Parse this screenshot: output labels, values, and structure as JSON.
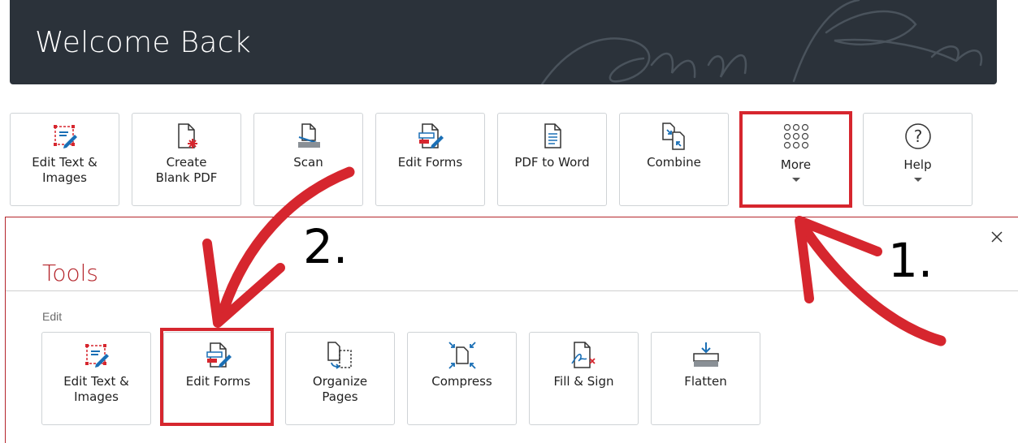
{
  "banner": {
    "title": "Welcome Back"
  },
  "top_tools": [
    {
      "label": "Edit Text &\nImages",
      "icon": "edit-text-images-icon"
    },
    {
      "label": "Create\nBlank PDF",
      "icon": "create-blank-pdf-icon"
    },
    {
      "label": "Scan",
      "icon": "scan-icon"
    },
    {
      "label": "Edit Forms",
      "icon": "edit-forms-icon"
    },
    {
      "label": "PDF to Word",
      "icon": "pdf-to-word-icon"
    },
    {
      "label": "Combine",
      "icon": "combine-icon"
    },
    {
      "label": "More",
      "icon": "grid-dots-icon"
    },
    {
      "label": "Help",
      "icon": "help-icon"
    }
  ],
  "tools_panel": {
    "title": "Tools",
    "section_label": "Edit",
    "tools": [
      {
        "label": "Edit Text &\nImages",
        "icon": "edit-text-images-icon"
      },
      {
        "label": "Edit Forms",
        "icon": "edit-forms-icon"
      },
      {
        "label": "Organize\nPages",
        "icon": "organize-pages-icon"
      },
      {
        "label": "Compress",
        "icon": "compress-icon"
      },
      {
        "label": "Fill & Sign",
        "icon": "fill-sign-icon"
      },
      {
        "label": "Flatten",
        "icon": "flatten-icon"
      }
    ]
  },
  "annotations": {
    "step1": "1.",
    "step2": "2.",
    "color": "#d6262e"
  },
  "colors": {
    "banner": "#2b323a",
    "accent": "#b5262c",
    "icon_blue": "#1a6fb5",
    "icon_red": "#d6262e"
  }
}
